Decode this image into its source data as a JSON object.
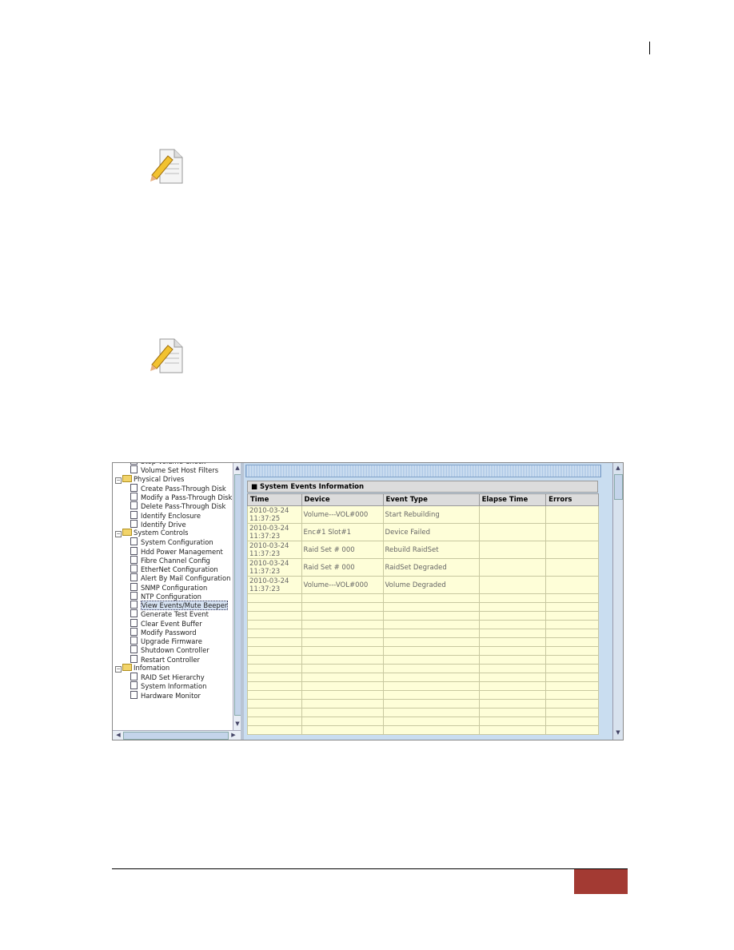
{
  "tree": {
    "items": [
      {
        "type": "leaf",
        "label": "Stop Volume Check"
      },
      {
        "type": "leaf",
        "label": "Volume Set Host Filters"
      },
      {
        "type": "folder",
        "label": "Physical Drives"
      },
      {
        "type": "leaf",
        "label": "Create Pass-Through Disk"
      },
      {
        "type": "leaf",
        "label": "Modify a Pass-Through Disk"
      },
      {
        "type": "leaf",
        "label": "Delete Pass-Through Disk"
      },
      {
        "type": "leaf",
        "label": "Identify Enclosure"
      },
      {
        "type": "leaf",
        "label": "Identify Drive"
      },
      {
        "type": "folder",
        "label": "System Controls"
      },
      {
        "type": "leaf",
        "label": "System Configuration"
      },
      {
        "type": "leaf",
        "label": "Hdd Power Management"
      },
      {
        "type": "leaf",
        "label": "Fibre Channel Config"
      },
      {
        "type": "leaf",
        "label": "EtherNet Configuration"
      },
      {
        "type": "leaf",
        "label": "Alert By Mail Configuration"
      },
      {
        "type": "leaf",
        "label": "SNMP Configuration"
      },
      {
        "type": "leaf",
        "label": "NTP Configuration"
      },
      {
        "type": "leaf",
        "label": "View Events/Mute Beeper",
        "selected": true
      },
      {
        "type": "leaf",
        "label": "Generate Test Event"
      },
      {
        "type": "leaf",
        "label": "Clear Event Buffer"
      },
      {
        "type": "leaf",
        "label": "Modify Password"
      },
      {
        "type": "leaf",
        "label": "Upgrade Firmware"
      },
      {
        "type": "leaf",
        "label": "Shutdown Controller"
      },
      {
        "type": "leaf",
        "label": "Restart Controller"
      },
      {
        "type": "folder",
        "label": "Infomation"
      },
      {
        "type": "leaf",
        "label": "RAID Set Hierarchy"
      },
      {
        "type": "leaf",
        "label": "System Information"
      },
      {
        "type": "leaf",
        "label": "Hardware Monitor"
      }
    ]
  },
  "events": {
    "title": "System Events Information",
    "columns": [
      "Time",
      "Device",
      "Event Type",
      "Elapse Time",
      "Errors"
    ],
    "rows": [
      {
        "date": "2010-03-24",
        "time": "11:37:25",
        "device": "Volume---VOL#000",
        "event": "Start Rebuilding",
        "elapse": "",
        "errors": ""
      },
      {
        "date": "2010-03-24",
        "time": "11:37:23",
        "device": "Enc#1 Slot#1",
        "event": "Device Failed",
        "elapse": "",
        "errors": ""
      },
      {
        "date": "2010-03-24",
        "time": "11:37:23",
        "device": "Raid Set # 000",
        "event": "Rebuild RaidSet",
        "elapse": "",
        "errors": ""
      },
      {
        "date": "2010-03-24",
        "time": "11:37:23",
        "device": "Raid Set # 000",
        "event": "RaidSet Degraded",
        "elapse": "",
        "errors": ""
      },
      {
        "date": "2010-03-24",
        "time": "11:37:23",
        "device": "Volume---VOL#000",
        "event": "Volume Degraded",
        "elapse": "",
        "errors": ""
      }
    ],
    "empty_rows": 16
  },
  "colors": {
    "table_cell": "#fefed8",
    "panel": "#c9ddf0",
    "footer_accent": "#a33a33"
  },
  "icons": [
    "note-pencil-icon",
    "folder-icon",
    "document-icon"
  ]
}
